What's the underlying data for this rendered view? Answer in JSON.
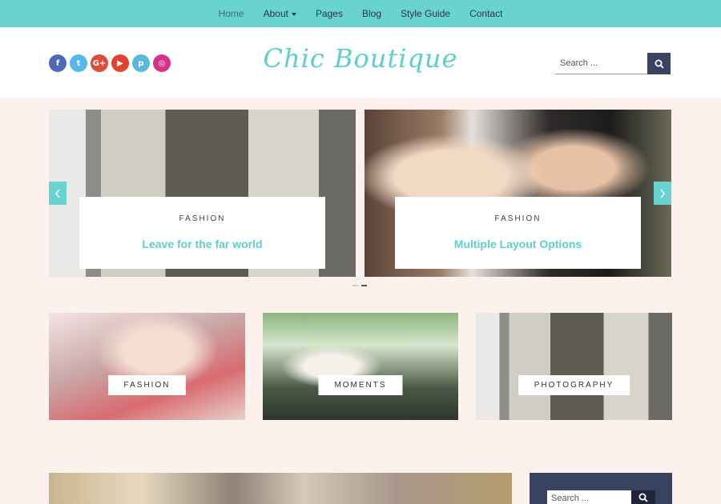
{
  "nav": {
    "items": [
      {
        "label": "Home",
        "active": true
      },
      {
        "label": "About",
        "dropdown": true
      },
      {
        "label": "Pages"
      },
      {
        "label": "Blog"
      },
      {
        "label": "Style Guide"
      },
      {
        "label": "Contact"
      }
    ]
  },
  "header": {
    "social": [
      {
        "icon": "facebook-icon",
        "glyph": "f",
        "color": "#4d6bb4"
      },
      {
        "icon": "twitter-icon",
        "glyph": "t",
        "color": "#56b8e8"
      },
      {
        "icon": "google-plus-icon",
        "glyph": "G+",
        "color": "#dd4b39"
      },
      {
        "icon": "youtube-icon",
        "glyph": "▶",
        "color": "#e3412d"
      },
      {
        "icon": "pinterest-icon",
        "glyph": "p",
        "color": "#5ab8e0"
      },
      {
        "icon": "instagram-icon",
        "glyph": "◎",
        "color": "#d6338b"
      }
    ],
    "logo": "Chic Boutique",
    "search_placeholder": "Search ..."
  },
  "slider": {
    "slides": [
      {
        "category": "FASHION",
        "title": "Leave for the far world"
      },
      {
        "category": "FASHION",
        "title": "Multiple Layout Options"
      }
    ]
  },
  "tiles": [
    {
      "label": "FASHION"
    },
    {
      "label": "MOMENTS"
    },
    {
      "label": "PHOTOGRAPHY"
    }
  ],
  "sidebar": {
    "search_placeholder": "Search ..."
  },
  "colors": {
    "accent": "#68d3d1",
    "logo": "#5ccfcd",
    "dark": "#3a4262",
    "background": "#fcf1ec"
  }
}
